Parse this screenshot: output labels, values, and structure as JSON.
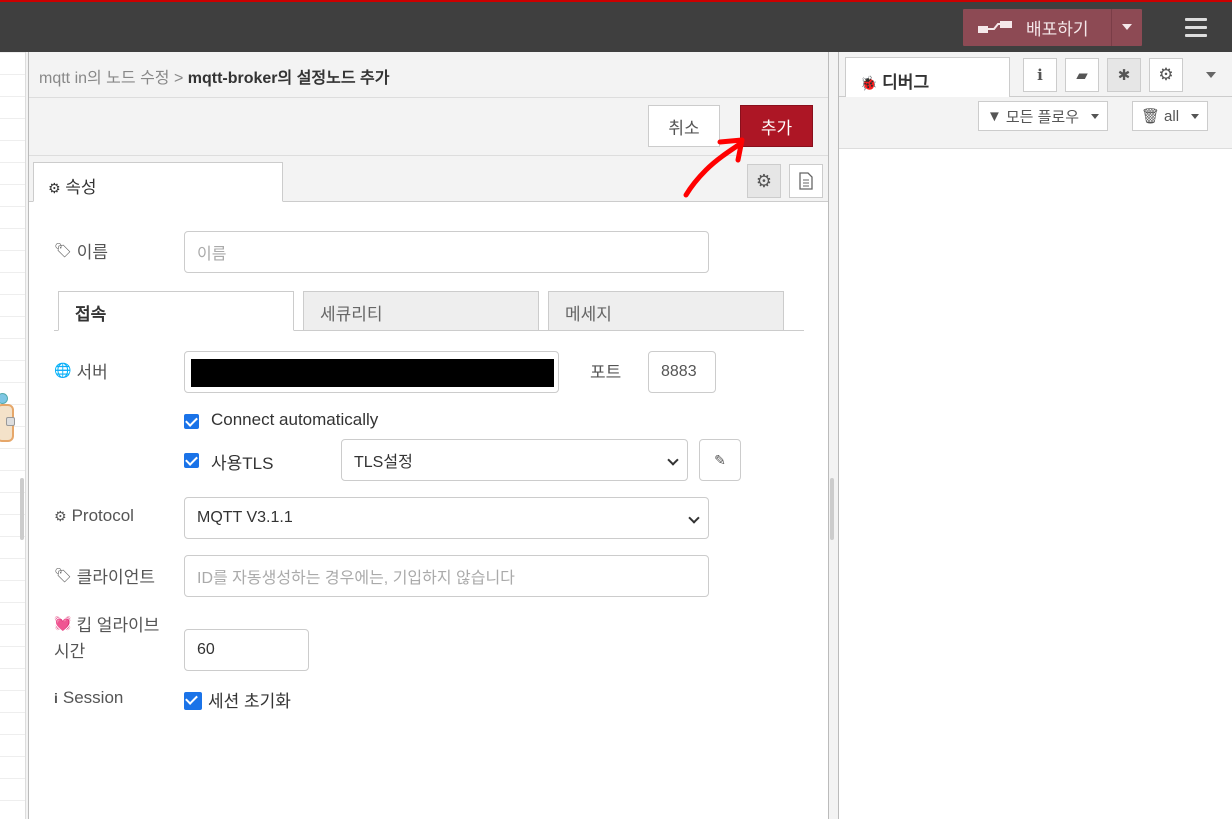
{
  "header": {
    "deploy_label": "배포하기"
  },
  "tray": {
    "breadcrumb_parent": "mqtt in의 노드 수정 > ",
    "breadcrumb_current": "mqtt-broker의 설정노드 추가",
    "cancel_label": "취소",
    "add_label": "추가",
    "properties_tab": "속성"
  },
  "form": {
    "name_label": "이름",
    "name_placeholder": "이름",
    "tabs": [
      "접속",
      "세큐리티",
      "메세지"
    ],
    "server_label": "서버",
    "port_label": "포트",
    "port_value": "8883",
    "connect_auto_label": "Connect automatically",
    "use_tls_label": "사용TLS",
    "tls_value": "TLS설정",
    "protocol_label": "Protocol",
    "protocol_value": "MQTT V3.1.1",
    "client_label": "클라이언트",
    "client_placeholder": "ID를 자동생성하는 경우에는, 기입하지 않습니다",
    "keepalive_label_1": "킵 얼라이브",
    "keepalive_label_2": "시간",
    "keepalive_value": "60",
    "session_label": "Session",
    "session_check_label": "세션 초기화"
  },
  "sidebar": {
    "debug_tab": "디버그",
    "filter_label": "모든 플로우",
    "clear_label": "all"
  },
  "colors": {
    "accent_red": "#ad1625",
    "deploy_bg": "#8d4a54",
    "checkbox_blue": "#1a73e8"
  }
}
